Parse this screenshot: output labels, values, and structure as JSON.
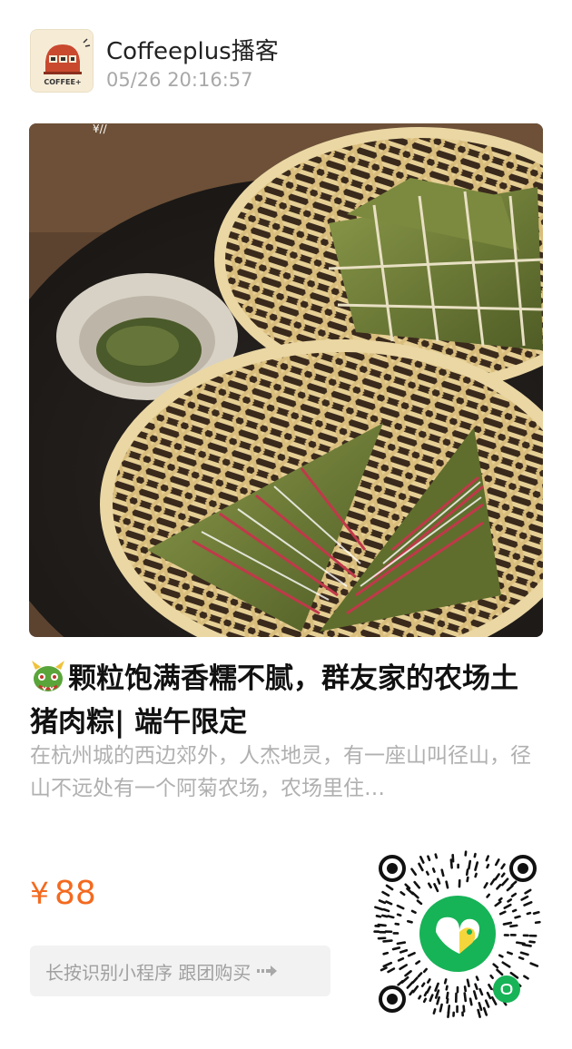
{
  "header": {
    "shop_name": "Coffeeplus播客",
    "timestamp": "05/26 20:16:57",
    "avatar_icon": "coffee-shop-logo-icon",
    "avatar_caption": "COFFEE+"
  },
  "product": {
    "title": "颗粒饱满香糯不腻，群友家的农场土猪肉粽| 端午限定",
    "title_icon": "dragon-emoji-icon",
    "description": "在杭州城的西边郊外，人杰地灵，有一座山叫径山，径山不远处有一个阿菊农场，农场里住…",
    "price_symbol": "¥",
    "price_value": "88"
  },
  "cta": {
    "label": "长按识别小程序 跟团购买",
    "icon": "arrow-right-icon"
  },
  "colors": {
    "price": "#f36a1f",
    "cta_bg": "#f2f2f2",
    "qr_center": "#17b357"
  }
}
